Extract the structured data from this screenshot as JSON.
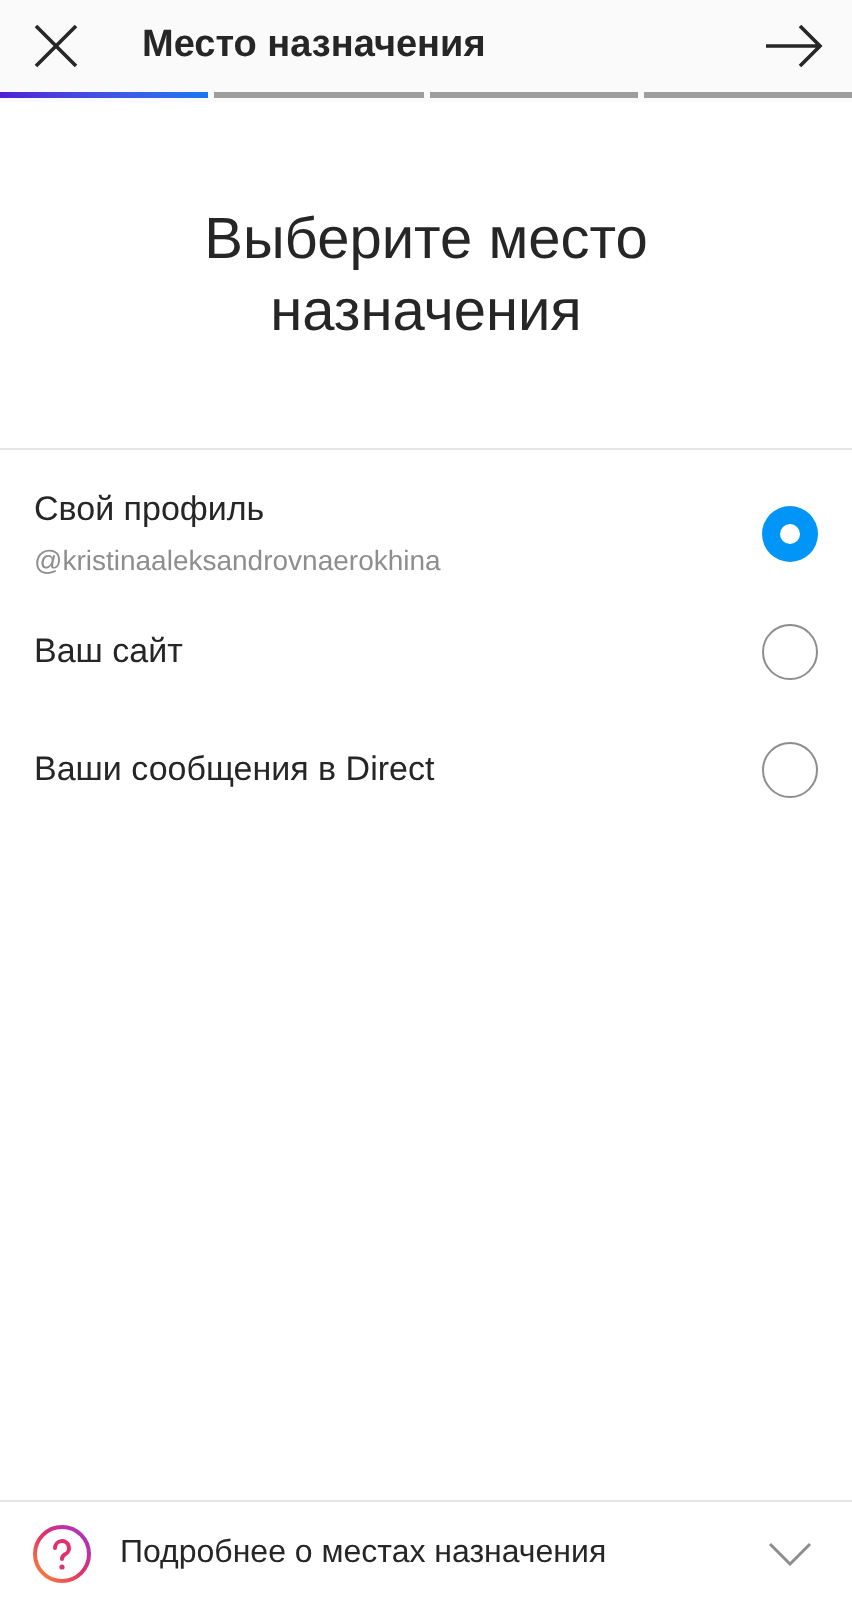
{
  "header": {
    "title": "Место назначения"
  },
  "steps": [
    {
      "done": true
    },
    {
      "done": false
    },
    {
      "done": false
    },
    {
      "done": false
    }
  ],
  "heading": "Выберите место назначения",
  "options": [
    {
      "label": "Свой профиль",
      "sublabel": "@kristinaaleksandrovnaerokhina",
      "selected": true
    },
    {
      "label": "Ваш сайт",
      "selected": false
    },
    {
      "label": "Ваши сообщения в Direct",
      "selected": false
    }
  ],
  "footer": {
    "label": "Подробнее о местах назначения"
  }
}
